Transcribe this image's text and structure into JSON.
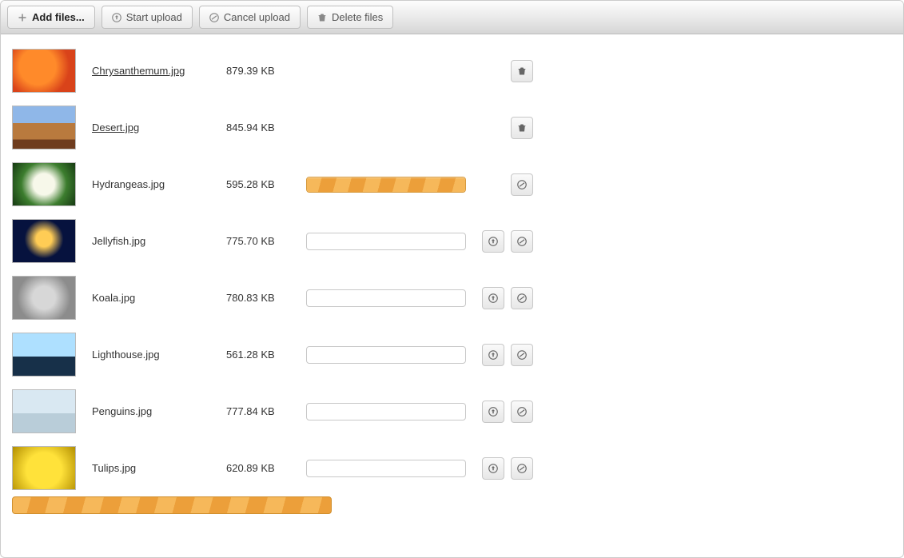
{
  "toolbar": {
    "add_label": "Add files...",
    "start_label": "Start upload",
    "cancel_label": "Cancel upload",
    "delete_label": "Delete files"
  },
  "files": [
    {
      "name": "Chrysanthemum.jpg",
      "size": "879.39 KB",
      "state": "done",
      "link": true,
      "progress_pct": 0
    },
    {
      "name": "Desert.jpg",
      "size": "845.94 KB",
      "state": "done",
      "link": true,
      "progress_pct": 0
    },
    {
      "name": "Hydrangeas.jpg",
      "size": "595.28 KB",
      "state": "uploading",
      "link": false,
      "progress_pct": 100
    },
    {
      "name": "Jellyfish.jpg",
      "size": "775.70 KB",
      "state": "queued",
      "link": false,
      "progress_pct": 0
    },
    {
      "name": "Koala.jpg",
      "size": "780.83 KB",
      "state": "queued",
      "link": false,
      "progress_pct": 0
    },
    {
      "name": "Lighthouse.jpg",
      "size": "561.28 KB",
      "state": "queued",
      "link": false,
      "progress_pct": 0
    },
    {
      "name": "Penguins.jpg",
      "size": "777.84 KB",
      "state": "queued",
      "link": false,
      "progress_pct": 0
    },
    {
      "name": "Tulips.jpg",
      "size": "620.89 KB",
      "state": "queued",
      "link": false,
      "progress_pct": 0
    }
  ],
  "icons": {
    "plus": "plus-icon",
    "upload": "upload-circle-icon",
    "cancel": "cancel-circle-icon",
    "trash": "trash-icon"
  }
}
